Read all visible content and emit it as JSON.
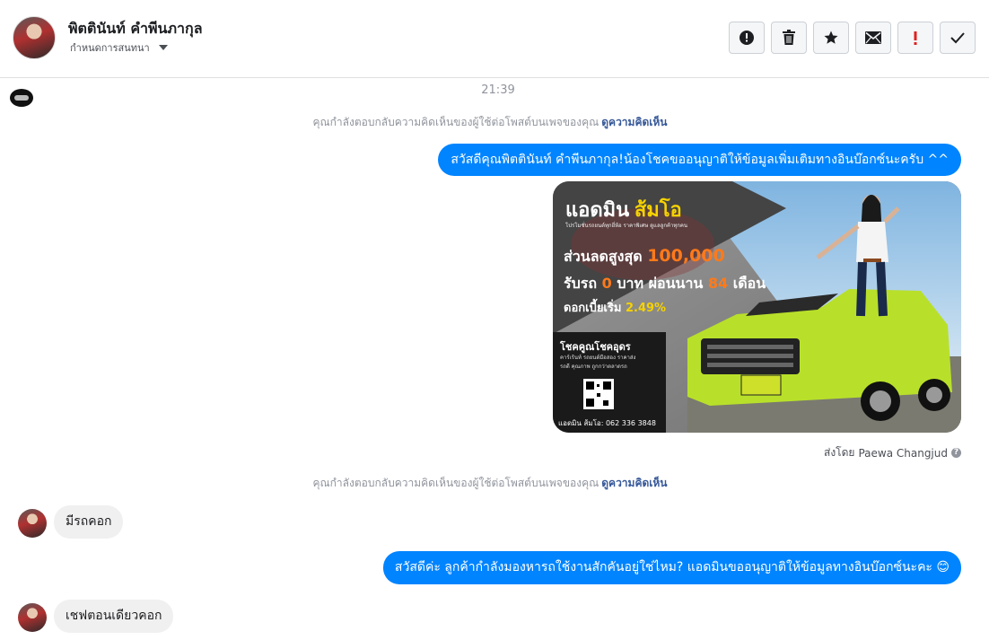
{
  "header": {
    "contact_name": "พิตตินันท์ คำพีนภากุล",
    "conversation_label": "กำหนดการสนทนา",
    "actions": [
      {
        "name": "report-spam",
        "icon": "exclamation-circle-icon"
      },
      {
        "name": "delete",
        "icon": "trash-icon"
      },
      {
        "name": "star",
        "icon": "star-icon"
      },
      {
        "name": "mark-unread",
        "icon": "envelope-icon"
      },
      {
        "name": "important",
        "icon": "red-exclamation-icon"
      },
      {
        "name": "mark-done",
        "icon": "checkmark-icon"
      }
    ]
  },
  "conversation": {
    "time": "21:39",
    "notice_text": "คุณกำลังตอบกลับความคิดเห็นของผู้ใช้ต่อโพสต์บนเพจของคุณ",
    "notice_link": "ดูความคิดเห็น",
    "messages": [
      {
        "from": "page",
        "text": "สวัสดีคุณพิตตินันท์ คำพีนภากุล!น้องโชคขออนุญาติให้ข้อมูลเพิ่มเติมทางอินบ๊อกซ์นะครับ ^^"
      },
      {
        "from": "customer",
        "text": "มีรถคอก"
      },
      {
        "from": "page",
        "text": "สวัสดีค่ะ ลูกค้ากำลังมองหารถใช้งานสักคันอยู่ใช่ไหม? แอดมินขออนุญาติให้ข้อมูลทางอินบ๊อกซ์นะคะ 😊"
      },
      {
        "from": "customer",
        "text": "เชฟตอนเดียวคอก"
      }
    ],
    "sent_by_prefix": "ส่งโดย",
    "sent_by_name": "Paewa Changjud"
  },
  "promo_image": {
    "title_white": "แอดมิน",
    "title_yellow": "ส้มโอ",
    "tagline": "โปรโมชั่นรถยนต์ทุกยี่ห้อ ราคาพิเศษ ดูแลลูกค้าทุกคน",
    "discount_label": "ส่วนลดสูงสุด",
    "discount_value": "100,000",
    "down_label": "รับรถ",
    "down_value": "0",
    "down_unit": "บาท ผ่อนนาน",
    "months_value": "84",
    "months_unit": "เดือน",
    "interest_label": "ดอกเบี้ยเริ่ม",
    "interest_value": "2.49%",
    "box_title": "โชคคูณโชคอุดร",
    "box_line1": "คาร์เร้นท์ รถยนต์มือสอง ราคาส่ง",
    "box_line2": "รถดี คุณภาพ ถูกกว่าตลาดรถ",
    "contact": "แอดมิน ส้มโอ: 062 336 3848",
    "colors": {
      "accent_yellow": "#f6d200",
      "accent_orange": "#ff7a1a",
      "car_green": "#b8e02a",
      "dark_panel": "#1a1a1a"
    }
  },
  "colors": {
    "bubble_out": "#0084ff",
    "bubble_in": "#f1f0f0",
    "link": "#365899",
    "muted": "#90949c"
  }
}
